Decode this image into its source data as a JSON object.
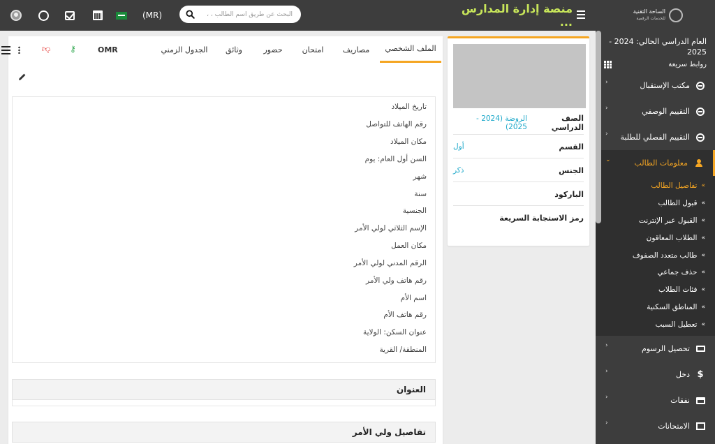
{
  "topbar": {
    "currency": "(MR)",
    "search_placeholder": "البحث عن طريق اسم الطالب ، ،",
    "app_title": "منصة إدارة المدارس ...",
    "logo_title": "الساحة التقنية",
    "logo_subtitle": "للخدمات الرقمية"
  },
  "sidebar": {
    "academic_year": "العام الدراسي الحالي: 2024 - 2025",
    "quick_links": "روابط سريعة",
    "items_top": [
      {
        "label": "مكتب الإستقبال",
        "icon": "ring-icon"
      },
      {
        "label": "التقييم الوصفي",
        "icon": "ring-icon"
      },
      {
        "label": "التقييم الفصلي للطلبة",
        "icon": "ring-icon"
      }
    ],
    "active_item": {
      "label": "معلومات الطالب",
      "icon": "user-plus-icon"
    },
    "sub_items": [
      "تفاصيل الطالب",
      "قبول الطالب",
      "القبول عبر الإنترنت",
      "الطلاب المعاقون",
      "طالب متعدد الصفوف",
      "حذف جماعي",
      "فئات الطلاب",
      "المناطق السكنية",
      "تعطيل السبب"
    ],
    "items_bottom": [
      {
        "label": "تحصيل الرسوم",
        "icon": "cash-icon"
      },
      {
        "label": "دخل",
        "icon": "dollar-icon"
      },
      {
        "label": "نفقات",
        "icon": "card-icon"
      },
      {
        "label": "الامتحانات",
        "icon": "map-icon"
      }
    ]
  },
  "student_card": {
    "rows": [
      {
        "label": "الصف الدراسي",
        "value": "الروضة (2024 - 2025)"
      },
      {
        "label": "القسم",
        "value": "أول"
      },
      {
        "label": "الجنس",
        "value": "ذكر"
      },
      {
        "label": "الباركود",
        "value": ""
      },
      {
        "label": "رمز الاستجابة السريعة",
        "value": ""
      }
    ]
  },
  "main": {
    "tabs": [
      "الملف الشخصي",
      "مصاريف",
      "امتحان",
      "حضور",
      "وثائق",
      "الجدول الزمني"
    ],
    "omr_label": "OMR",
    "fields": [
      "تاريخ الميلاد",
      "رقم الهاتف للتواصل",
      "مكان الميلاد",
      "السن أول العام: يوم",
      "شهر",
      "سنة",
      "الجنسية",
      "الإسم الثلاثي لولي الأمر",
      "مكان العمل",
      "الرقم المدني لولي الأمر",
      "رقم هاتف ولي الأمر",
      "اسم الأم",
      "رقم هاتف الأم",
      "عنوان السكن: الولاية",
      "المنطقة/ القرية"
    ],
    "section_address": "العنوان",
    "section_guardian": "تفاصيل ولي الأمر"
  }
}
